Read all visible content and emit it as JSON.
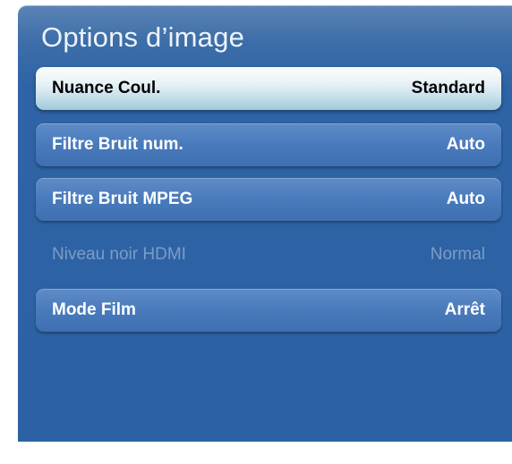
{
  "menu": {
    "title": "Options d’image",
    "items": [
      {
        "label": "Nuance Coul.",
        "value": "Standard",
        "state": "selected"
      },
      {
        "label": "Filtre Bruit num.",
        "value": "Auto",
        "state": "normal"
      },
      {
        "label": "Filtre Bruit MPEG",
        "value": "Auto",
        "state": "normal"
      },
      {
        "label": "Niveau noir HDMI",
        "value": "Normal",
        "state": "disabled"
      },
      {
        "label": "Mode Film",
        "value": "Arrêt",
        "state": "normal"
      }
    ]
  }
}
